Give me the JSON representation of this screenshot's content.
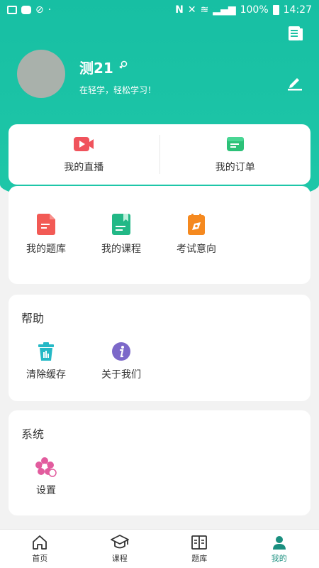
{
  "status_bar": {
    "battery": "100%",
    "time": "14:27"
  },
  "profile": {
    "username": "测21",
    "slogan": "在轻学，轻松学习！"
  },
  "quick_actions": [
    {
      "label": "我的直播",
      "icon": "video-camera-icon",
      "color": "#f0535c"
    },
    {
      "label": "我的订单",
      "icon": "order-list-icon",
      "color": "#2cc178"
    }
  ],
  "my_items": [
    {
      "label": "我的题库",
      "icon": "question-bank-icon",
      "color": "#f25a55"
    },
    {
      "label": "我的课程",
      "icon": "course-book-icon",
      "color": "#22b886"
    },
    {
      "label": "考试意向",
      "icon": "exam-intent-icon",
      "color": "#f5891f"
    }
  ],
  "help": {
    "title": "帮助",
    "items": [
      {
        "label": "清除缓存",
        "icon": "clear-cache-icon",
        "color": "#25b9c6"
      },
      {
        "label": "关于我们",
        "icon": "about-info-icon",
        "color": "#7c68c9"
      }
    ]
  },
  "system": {
    "title": "系统",
    "items": [
      {
        "label": "设置",
        "icon": "settings-flower-icon",
        "color": "#e25c9e"
      }
    ]
  },
  "bottom_nav": [
    {
      "label": "首页",
      "icon": "home-icon",
      "active": false
    },
    {
      "label": "课程",
      "icon": "graduation-cap-icon",
      "active": false
    },
    {
      "label": "题库",
      "icon": "question-bank-nav-icon",
      "active": false
    },
    {
      "label": "我的",
      "icon": "user-icon",
      "active": true
    }
  ],
  "colors": {
    "brand": "#1fc1a4",
    "active_nav": "#1a8f7f"
  }
}
